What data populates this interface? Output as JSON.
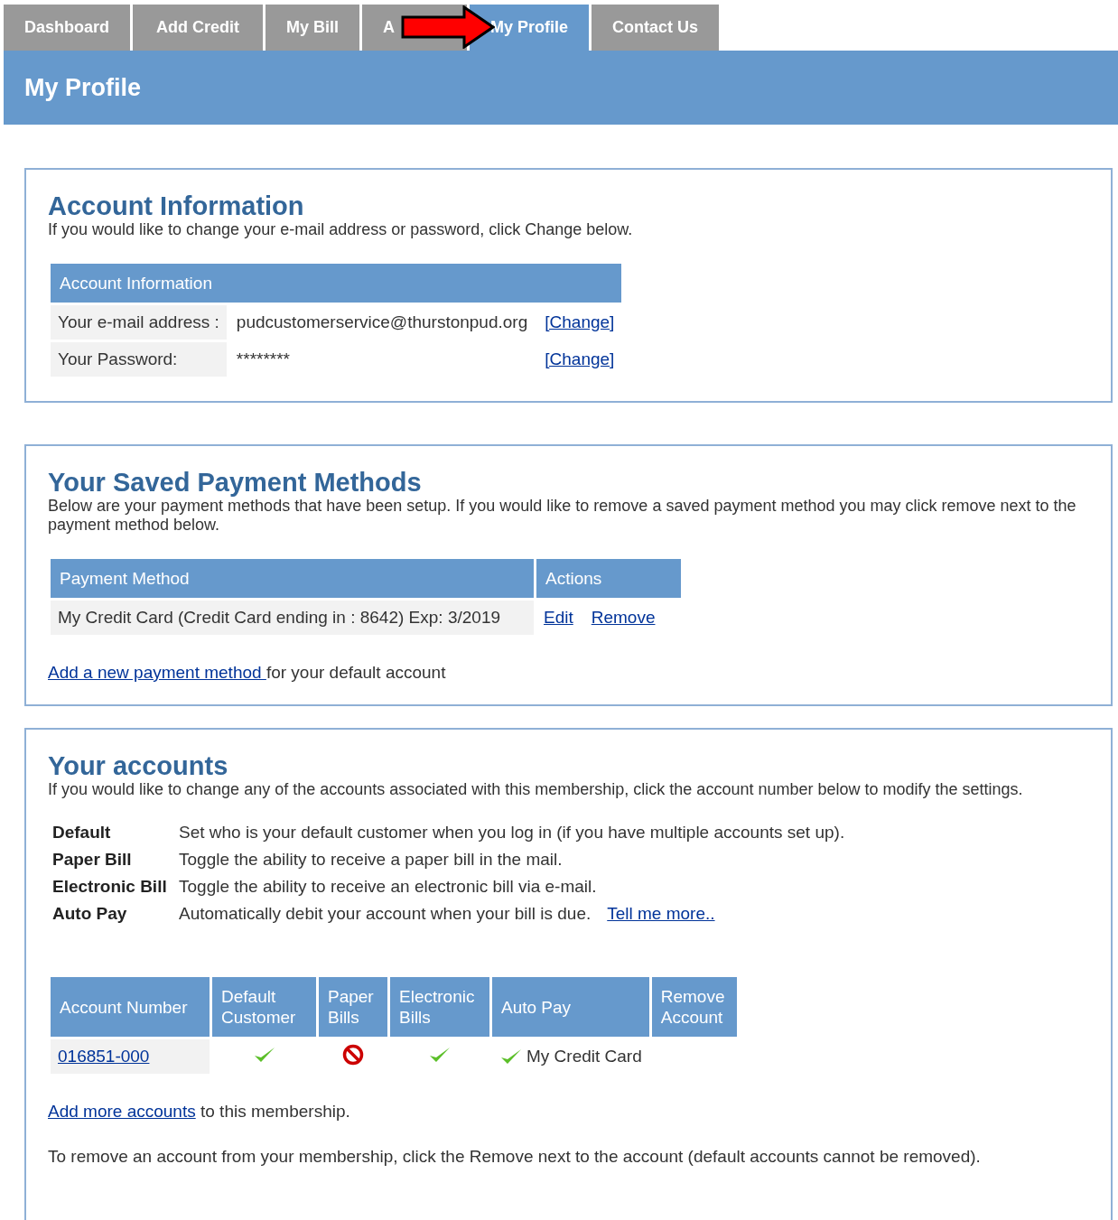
{
  "tabs": [
    {
      "label": "Dashboard",
      "selected": false
    },
    {
      "label": "Add Credit",
      "selected": false
    },
    {
      "label": "My Bill",
      "selected": false
    },
    {
      "label": "A",
      "selected": false
    },
    {
      "label": "My Profile",
      "selected": true
    },
    {
      "label": "Contact Us",
      "selected": false
    }
  ],
  "page_title": "My Profile",
  "account_info": {
    "title": "Account Information",
    "intro": "If you would like to change your e-mail address or password, click Change below.",
    "table_title": "Account Information",
    "rows": [
      {
        "label": "Your e-mail address :",
        "value": "pudcustomerservice@thurstonpud.org",
        "link": "[Change]"
      },
      {
        "label": "Your Password:",
        "value": "********",
        "link": "[Change]"
      }
    ]
  },
  "payment_methods": {
    "title": "Your Saved Payment Methods",
    "intro": "Below are your payment methods that have been setup. If you would like to remove a saved payment method you may click remove next to the payment method below.",
    "columns": [
      "Payment Method",
      "Actions"
    ],
    "rows": [
      {
        "method": "My Credit Card (Credit Card ending in : 8642) Exp: 3/2019",
        "actions": [
          "Edit",
          "Remove"
        ]
      }
    ],
    "add_link": "Add a new payment method ",
    "add_suffix": "for your default account"
  },
  "accounts": {
    "title": "Your accounts",
    "intro": "If you would like to change any of the accounts associated with this membership, click the account number below to modify the settings.",
    "legend": [
      {
        "term": "Default",
        "desc": "Set who is your default customer when you log in (if you have multiple accounts set up)."
      },
      {
        "term": "Paper Bill",
        "desc": "Toggle the ability to receive a paper bill in the mail."
      },
      {
        "term": "Electronic Bill",
        "desc": "Toggle the ability to receive an electronic bill via e-mail."
      },
      {
        "term": "Auto Pay",
        "desc": "Automatically debit your account when your bill is due.",
        "link": "Tell me more.."
      }
    ],
    "columns": [
      "Account Number",
      "Default Customer",
      "Paper Bills",
      "Electronic Bills",
      "Auto Pay",
      "Remove Account"
    ],
    "rows": [
      {
        "number": "016851-000",
        "default": true,
        "paper": false,
        "electronic": true,
        "autopay": true,
        "autopay_method": "My Credit Card"
      }
    ],
    "add_link": "Add more accounts",
    "add_suffix": "to this membership.",
    "note": "To remove an account from your membership, click the Remove next to the account (default accounts cannot be removed)."
  }
}
